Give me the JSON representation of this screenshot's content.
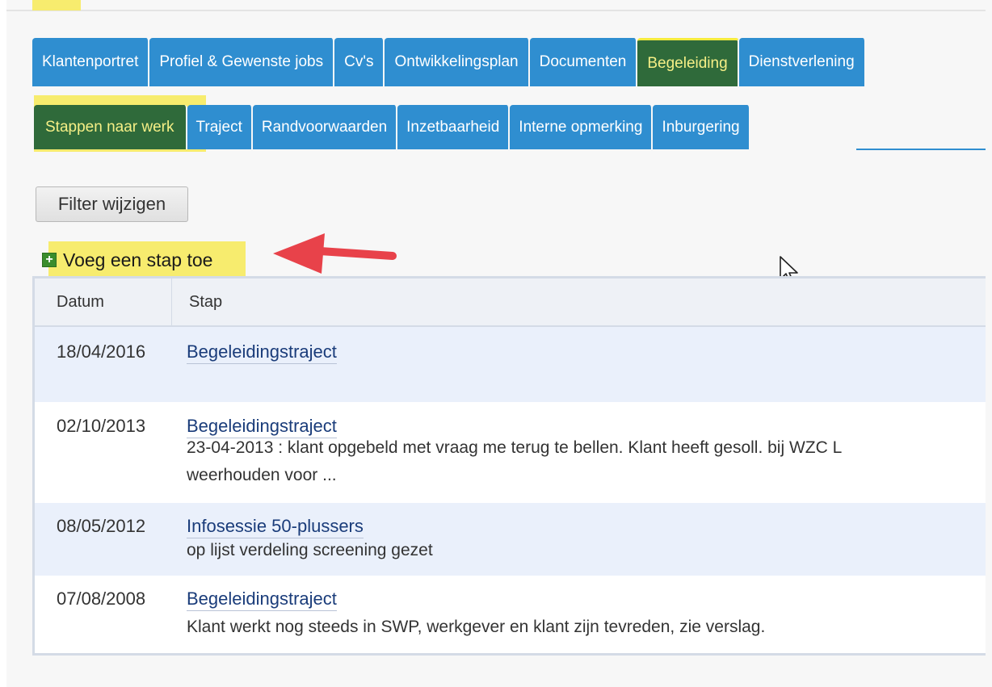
{
  "main_tabs": [
    {
      "label": "Klantenportret"
    },
    {
      "label": "Profiel & Gewenste jobs"
    },
    {
      "label": "Cv's"
    },
    {
      "label": "Ontwikkelingsplan"
    },
    {
      "label": "Documenten"
    },
    {
      "label": "Begeleiding",
      "active": true
    },
    {
      "label": "Dienstverlening"
    }
  ],
  "sub_tabs": [
    {
      "label": "Stappen naar werk",
      "active": true
    },
    {
      "label": "Traject"
    },
    {
      "label": "Randvoorwaarden"
    },
    {
      "label": "Inzetbaarheid"
    },
    {
      "label": "Interne opmerking"
    },
    {
      "label": "Inburgering"
    }
  ],
  "filter_button": "Filter wijzigen",
  "add_step": "Voeg een stap toe",
  "table": {
    "headers": {
      "date": "Datum",
      "step": "Stap"
    },
    "rows": [
      {
        "date": "18/04/2016",
        "title": "Begeleidingstraject",
        "desc1": "",
        "desc2": ""
      },
      {
        "date": "02/10/2013",
        "title": "Begeleidingstraject",
        "desc1": "23-04-2013 : klant opgebeld met vraag me terug te bellen. Klant heeft gesoll. bij WZC L",
        "desc2": "weerhouden voor ..."
      },
      {
        "date": "08/05/2012",
        "title": "Infosessie 50-plussers",
        "desc1": "op lijst verdeling screening gezet",
        "desc2": ""
      },
      {
        "date": "07/08/2008",
        "title": "Begeleidingstraject",
        "desc1": "Klant werkt nog steeds in SWP, werkgever en klant zijn tevreden, zie verslag.",
        "desc2": ""
      }
    ]
  },
  "colors": {
    "tab_blue": "#2f8ed0",
    "tab_active_green": "#2f6a3a",
    "highlight_yellow": "#f7ec6e",
    "annotation_arrow": "#e8424a"
  }
}
